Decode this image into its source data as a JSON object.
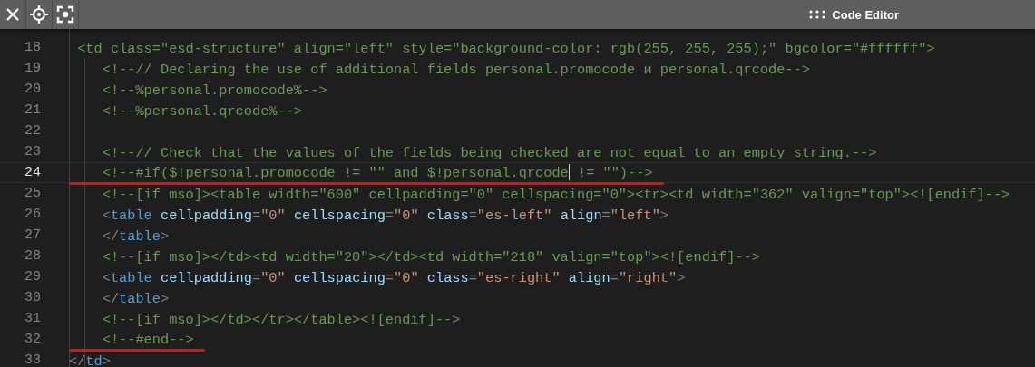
{
  "toolbar": {
    "title": "Code Editor"
  },
  "lines": [
    {
      "number": "18",
      "current": false,
      "underlined": false,
      "tokens": [
        {
          "kind": "comment",
          "text": " <td class=\"esd-structure\" align=\"left\" style=\"background-color: rgb(255, 255, 255);\" bgcolor=\"#ffffff\">"
        }
      ]
    },
    {
      "number": "19",
      "current": false,
      "underlined": false,
      "tokens": [
        {
          "kind": "comment",
          "text": "    <!--// Declaring the use of additional fields personal.promocode и personal.qrcode-->"
        }
      ]
    },
    {
      "number": "20",
      "current": false,
      "underlined": false,
      "tokens": [
        {
          "kind": "comment",
          "text": "    <!--%personal.promocode%-->"
        }
      ]
    },
    {
      "number": "21",
      "current": false,
      "underlined": false,
      "tokens": [
        {
          "kind": "comment",
          "text": "    <!--%personal.qrcode%-->"
        }
      ]
    },
    {
      "number": "22",
      "current": false,
      "underlined": false
    },
    {
      "number": "23",
      "current": false,
      "underlined": false,
      "tokens": [
        {
          "kind": "comment",
          "text": "    <!--// Check that the values of the fields being checked are not equal to an empty string.-->"
        }
      ]
    },
    {
      "number": "24",
      "current": true,
      "underlined": true,
      "tokens": [
        {
          "kind": "comment",
          "text": "    <!--#if($!personal.promocode != \"\" and $!personal.qrcode"
        },
        {
          "kind": "cursor"
        },
        {
          "kind": "comment",
          "text": " != \"\")-->"
        }
      ]
    },
    {
      "number": "25",
      "current": false,
      "underlined": false,
      "tokens": [
        {
          "kind": "comment",
          "text": "    <!--[if mso]><table width=\"600\" cellpadding=\"0\" cellspacing=\"0\"><tr><td width=\"362\" valign=\"top\"><![endif]-->"
        }
      ]
    },
    {
      "number": "26",
      "current": false,
      "underlined": false,
      "tokens": [
        {
          "kind": "punct",
          "text": "    <"
        },
        {
          "kind": "tag",
          "text": "table"
        },
        {
          "kind": "attr",
          "text": " cellpadding"
        },
        {
          "kind": "punct",
          "text": "="
        },
        {
          "kind": "value",
          "text": "\"0\""
        },
        {
          "kind": "attr",
          "text": " cellspacing"
        },
        {
          "kind": "punct",
          "text": "="
        },
        {
          "kind": "value",
          "text": "\"0\""
        },
        {
          "kind": "attr",
          "text": " class"
        },
        {
          "kind": "punct",
          "text": "="
        },
        {
          "kind": "value",
          "text": "\"es-left\""
        },
        {
          "kind": "attr",
          "text": " align"
        },
        {
          "kind": "punct",
          "text": "="
        },
        {
          "kind": "value",
          "text": "\"left\""
        },
        {
          "kind": "punct",
          "text": ">"
        }
      ]
    },
    {
      "number": "27",
      "current": false,
      "underlined": false,
      "tokens": [
        {
          "kind": "punct",
          "text": "    </"
        },
        {
          "kind": "tag",
          "text": "table"
        },
        {
          "kind": "punct",
          "text": ">"
        }
      ]
    },
    {
      "number": "28",
      "current": false,
      "underlined": false,
      "tokens": [
        {
          "kind": "comment",
          "text": "    <!--[if mso]></td><td width=\"20\"></td><td width=\"218\" valign=\"top\"><![endif]-->"
        }
      ]
    },
    {
      "number": "29",
      "current": false,
      "underlined": false,
      "tokens": [
        {
          "kind": "punct",
          "text": "    <"
        },
        {
          "kind": "tag",
          "text": "table"
        },
        {
          "kind": "attr",
          "text": " cellpadding"
        },
        {
          "kind": "punct",
          "text": "="
        },
        {
          "kind": "value",
          "text": "\"0\""
        },
        {
          "kind": "attr",
          "text": " cellspacing"
        },
        {
          "kind": "punct",
          "text": "="
        },
        {
          "kind": "value",
          "text": "\"0\""
        },
        {
          "kind": "attr",
          "text": " class"
        },
        {
          "kind": "punct",
          "text": "="
        },
        {
          "kind": "value",
          "text": "\"es-right\""
        },
        {
          "kind": "attr",
          "text": " align"
        },
        {
          "kind": "punct",
          "text": "="
        },
        {
          "kind": "value",
          "text": "\"right\""
        },
        {
          "kind": "punct",
          "text": ">"
        }
      ]
    },
    {
      "number": "30",
      "current": false,
      "underlined": false,
      "tokens": [
        {
          "kind": "punct",
          "text": "    </"
        },
        {
          "kind": "tag",
          "text": "table"
        },
        {
          "kind": "punct",
          "text": ">"
        }
      ]
    },
    {
      "number": "31",
      "current": false,
      "underlined": false,
      "tokens": [
        {
          "kind": "comment",
          "text": "    <!--[if mso]></td></tr></table><![endif]-->"
        }
      ]
    },
    {
      "number": "32",
      "current": false,
      "underlined": true,
      "tokens": [
        {
          "kind": "comment",
          "text": "    <!--#end-->"
        }
      ]
    },
    {
      "number": "33",
      "current": false,
      "underlined": false,
      "tokens": [
        {
          "kind": "punct",
          "text": "</"
        },
        {
          "kind": "tag",
          "text": "td"
        },
        {
          "kind": "punct",
          "text": ">"
        }
      ]
    }
  ]
}
